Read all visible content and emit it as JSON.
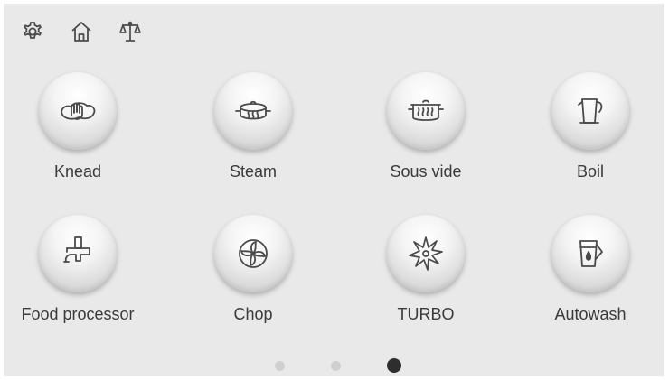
{
  "topbar": {
    "icons": [
      "gear-icon",
      "home-icon",
      "scale-icon"
    ]
  },
  "functions": [
    {
      "label": "Knead",
      "icon": "dough-hand-icon"
    },
    {
      "label": "Steam",
      "icon": "steamer-icon"
    },
    {
      "label": "Sous vide",
      "icon": "sous-vide-pot-icon"
    },
    {
      "label": "Boil",
      "icon": "kettle-icon"
    },
    {
      "label": "Food processor",
      "icon": "food-processor-icon"
    },
    {
      "label": "Chop",
      "icon": "chop-blade-icon"
    },
    {
      "label": "TURBO",
      "icon": "turbo-star-icon"
    },
    {
      "label": "Autowash",
      "icon": "wash-jug-icon"
    }
  ],
  "pagination": {
    "pages": 3,
    "active_page": 3
  },
  "colors": {
    "background": "#e9e9e9",
    "icon_stroke": "#4a4a4a",
    "dot_inactive": "#cfcfcf",
    "dot_active": "#2e2e2e"
  }
}
